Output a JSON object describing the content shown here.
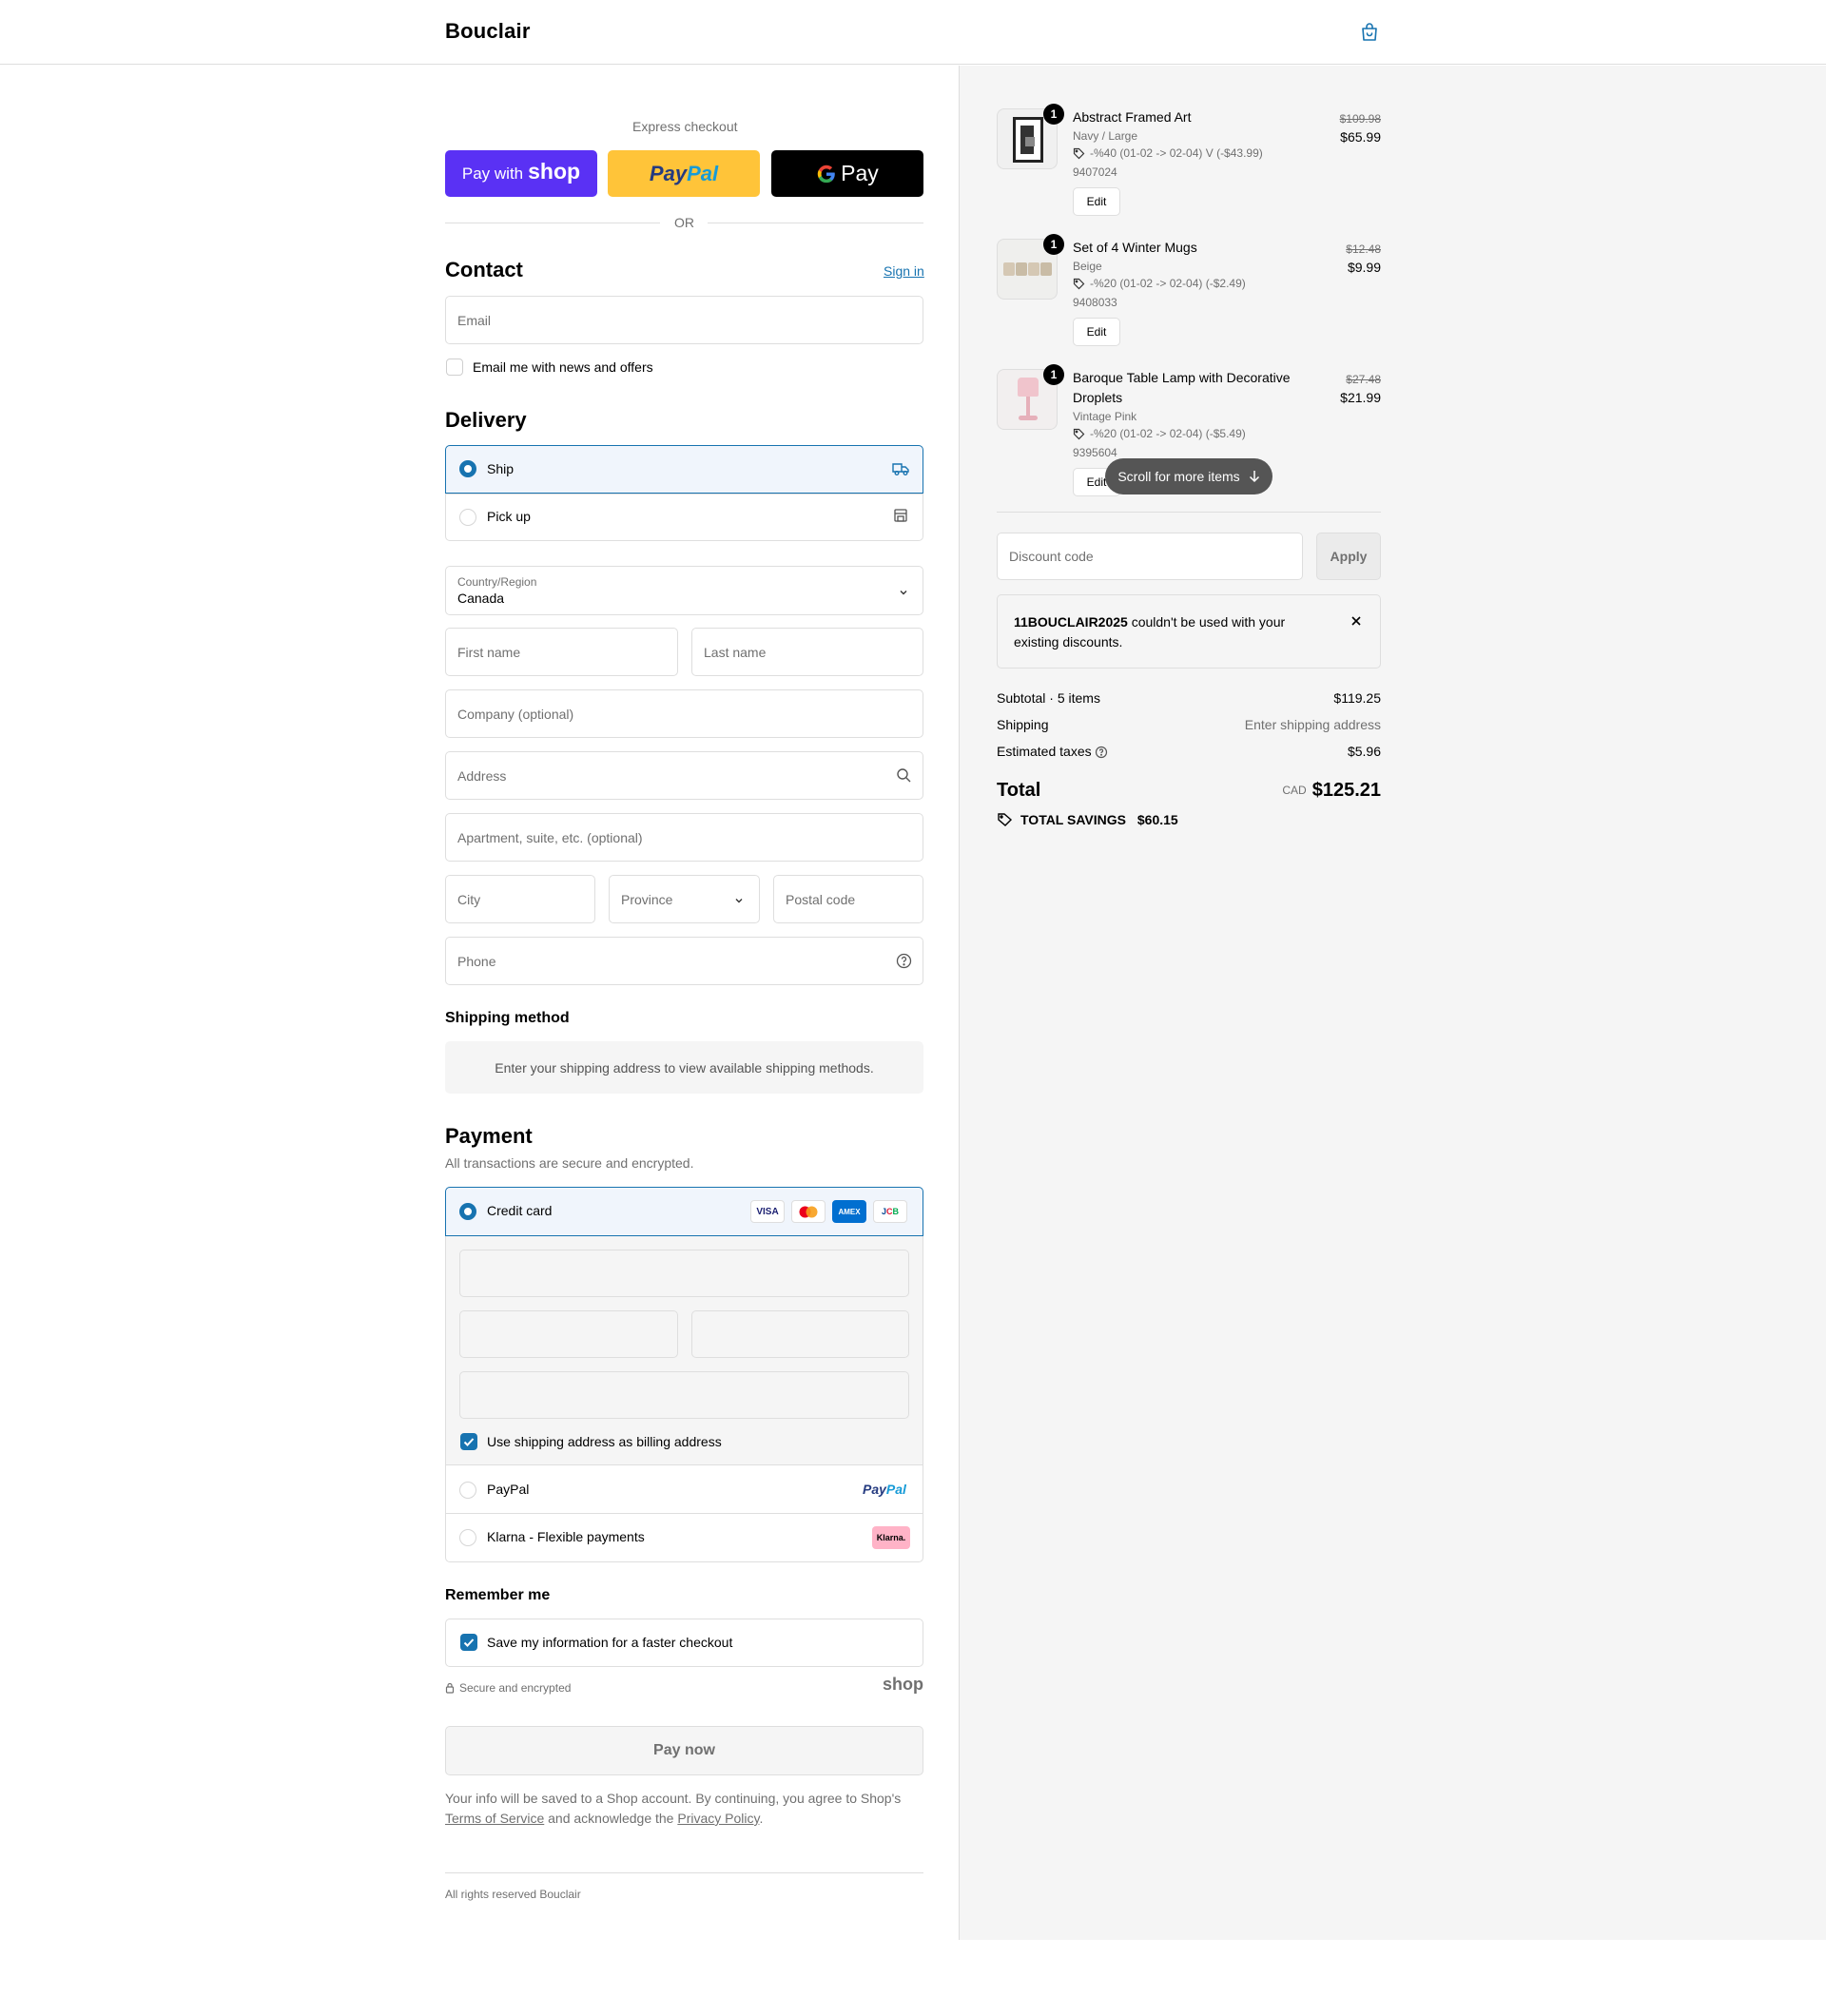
{
  "header": {
    "brand": "Bouclair"
  },
  "express": {
    "label": "Express checkout",
    "shop_pay_prefix": "Pay with",
    "shop_pay_brand": "shop",
    "paypal_a": "Pay",
    "paypal_b": "Pal",
    "gpay_text": "Pay",
    "or": "OR"
  },
  "contact": {
    "title": "Contact",
    "sign_in": "Sign in",
    "email_placeholder": "Email",
    "news_label": "Email me with news and offers"
  },
  "delivery": {
    "title": "Delivery",
    "ship": "Ship",
    "pickup": "Pick up",
    "country_label": "Country/Region",
    "country_value": "Canada",
    "first_name": "First name",
    "last_name": "Last name",
    "company": "Company (optional)",
    "address": "Address",
    "apartment": "Apartment, suite, etc. (optional)",
    "city": "City",
    "province": "Province",
    "postal": "Postal code",
    "phone": "Phone"
  },
  "shipping_method": {
    "title": "Shipping method",
    "message": "Enter your shipping address to view available shipping methods."
  },
  "payment": {
    "title": "Payment",
    "subtitle": "All transactions are secure and encrypted.",
    "credit_card": "Credit card",
    "card_logos": [
      "VISA",
      "mastercard",
      "AMEX",
      "JCB"
    ],
    "billing_same": "Use shipping address as billing address",
    "paypal": "PayPal",
    "paypal_logo_a": "Pay",
    "paypal_logo_b": "Pal",
    "klarna": "Klarna - Flexible payments",
    "klarna_logo": "Klarna."
  },
  "remember": {
    "title": "Remember me",
    "save_label": "Save my information for a faster checkout",
    "secure": "Secure and encrypted",
    "shop_logo": "shop"
  },
  "pay_now": "Pay now",
  "legal": {
    "text_a": "Your info will be saved to a Shop account. By continuing, you agree to Shop's",
    "terms": "Terms of Service",
    "text_b": "and acknowledge the",
    "privacy": "Privacy Policy",
    "text_c": "."
  },
  "footer": {
    "rights": "All rights reserved Bouclair"
  },
  "cart": {
    "items": [
      {
        "title": "Abstract Framed Art",
        "variant": "Navy / Large",
        "discount": "-%40 (01-02 -> 02-04) V (-$43.99)",
        "sku": "9407024",
        "qty": "1",
        "price_old": "$109.98",
        "price_new": "$65.99",
        "edit": "Edit"
      },
      {
        "title": "Set of 4 Winter Mugs",
        "variant": "Beige",
        "discount": "-%20 (01-02 -> 02-04) (-$2.49)",
        "sku": "9408033",
        "qty": "1",
        "price_old": "$12.48",
        "price_new": "$9.99",
        "edit": "Edit"
      },
      {
        "title_line1": "Baroque Table Lamp with Decorative",
        "title_line2": "Droplets",
        "variant": "Vintage Pink",
        "discount": "-%20 (01-02 -> 02-04) (-$5.49)",
        "sku": "9395604",
        "qty": "1",
        "price_old": "$27.48",
        "price_new": "$21.99",
        "edit": "Edit"
      }
    ],
    "scroll_hint": "Scroll for more items",
    "discount_placeholder": "Discount code",
    "apply": "Apply",
    "error_code": "11BOUCLAIR2025",
    "error_rest": " couldn't be used with your",
    "error_line2": "existing discounts.",
    "subtotal_label": "Subtotal · 5 items",
    "subtotal_value": "$119.25",
    "shipping_label": "Shipping",
    "shipping_value": "Enter shipping address",
    "taxes_label": "Estimated taxes",
    "taxes_value": "$5.96",
    "total_label": "Total",
    "total_currency": "CAD",
    "total_value": "$125.21",
    "savings_label": "TOTAL SAVINGS",
    "savings_value": "$60.15"
  },
  "colors": {
    "accent": "#1773b0",
    "shop_pay": "#5a31f4",
    "paypal_yellow": "#ffc439",
    "summary_bg": "#f5f5f5"
  }
}
